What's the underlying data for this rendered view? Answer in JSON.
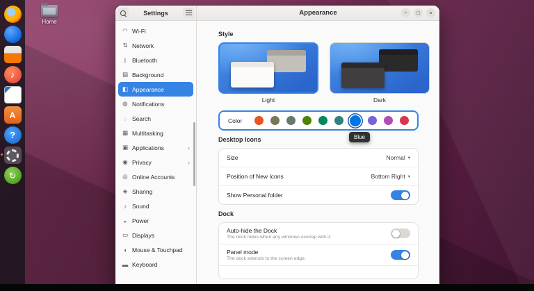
{
  "desktop": {
    "home_label": "Home",
    "dock": {
      "icons": [
        {
          "name": "firefox",
          "glyph": ""
        },
        {
          "name": "thunderbird",
          "glyph": ""
        },
        {
          "name": "files",
          "glyph": ""
        },
        {
          "name": "rhythmbox",
          "glyph": "♪"
        },
        {
          "name": "libreoffice-writer",
          "glyph": ""
        },
        {
          "name": "ubuntu-software",
          "glyph": "A"
        },
        {
          "name": "help",
          "glyph": "?"
        },
        {
          "name": "settings",
          "active": true
        },
        {
          "name": "software-updater",
          "glyph": "↻"
        }
      ]
    }
  },
  "window": {
    "sidebar": {
      "title": "Settings",
      "expander_glyph": "›",
      "items": [
        {
          "label": "Wi-Fi",
          "glyph": "◠"
        },
        {
          "label": "Network",
          "glyph": "⇅"
        },
        {
          "label": "Bluetooth",
          "glyph": "ᛒ"
        },
        {
          "label": "Background",
          "glyph": "▤"
        },
        {
          "label": "Appearance",
          "glyph": "◧",
          "selected": true
        },
        {
          "label": "Notifications",
          "glyph": "◍"
        },
        {
          "label": "Search",
          "glyph": "◌"
        },
        {
          "label": "Multitasking",
          "glyph": "▦"
        },
        {
          "label": "Applications",
          "glyph": "▣",
          "expander": true
        },
        {
          "label": "Privacy",
          "glyph": "◉",
          "expander": true
        },
        {
          "label": "Online Accounts",
          "glyph": "◎"
        },
        {
          "label": "Sharing",
          "glyph": "◈"
        },
        {
          "label": "Sound",
          "glyph": "♪"
        },
        {
          "label": "Power",
          "glyph": "◒"
        },
        {
          "label": "Displays",
          "glyph": "▭"
        },
        {
          "label": "Mouse & Touchpad",
          "glyph": "◖"
        },
        {
          "label": "Keyboard",
          "glyph": "▬"
        }
      ]
    },
    "header": {
      "title": "Appearance",
      "controls": {
        "minimize": "−",
        "maximize": "□",
        "close": "×"
      }
    },
    "content": {
      "chevron_down": "▾",
      "style": {
        "title": "Style",
        "options": [
          {
            "label": "Light",
            "selected": true
          },
          {
            "label": "Dark",
            "selected": false
          }
        ]
      },
      "color": {
        "label": "Color",
        "tooltip": "Blue",
        "swatches": [
          {
            "name": "orange",
            "hex": "#E95420"
          },
          {
            "name": "bark",
            "hex": "#787859"
          },
          {
            "name": "sage",
            "hex": "#657B69"
          },
          {
            "name": "olive",
            "hex": "#4B8501"
          },
          {
            "name": "viridian",
            "hex": "#03875B"
          },
          {
            "name": "prussian-green",
            "hex": "#308280"
          },
          {
            "name": "blue",
            "hex": "#0073E5",
            "selected": true
          },
          {
            "name": "purple",
            "hex": "#7764D8"
          },
          {
            "name": "magenta",
            "hex": "#B34CB3"
          },
          {
            "name": "red",
            "hex": "#DA3450"
          }
        ]
      },
      "desktop_icons": {
        "title": "Desktop Icons",
        "rows": [
          {
            "label": "Size",
            "value": "Normal"
          },
          {
            "label": "Position of New Icons",
            "value": "Bottom Right"
          },
          {
            "label": "Show Personal folder",
            "on": true
          }
        ]
      },
      "dock_section": {
        "title": "Dock",
        "rows": [
          {
            "label": "Auto-hide the Dock",
            "subtitle": "The dock hides when any windows overlap with it.",
            "on": false
          },
          {
            "label": "Panel mode",
            "subtitle": "The dock extends to the screen edge.",
            "on": true
          }
        ]
      }
    }
  }
}
